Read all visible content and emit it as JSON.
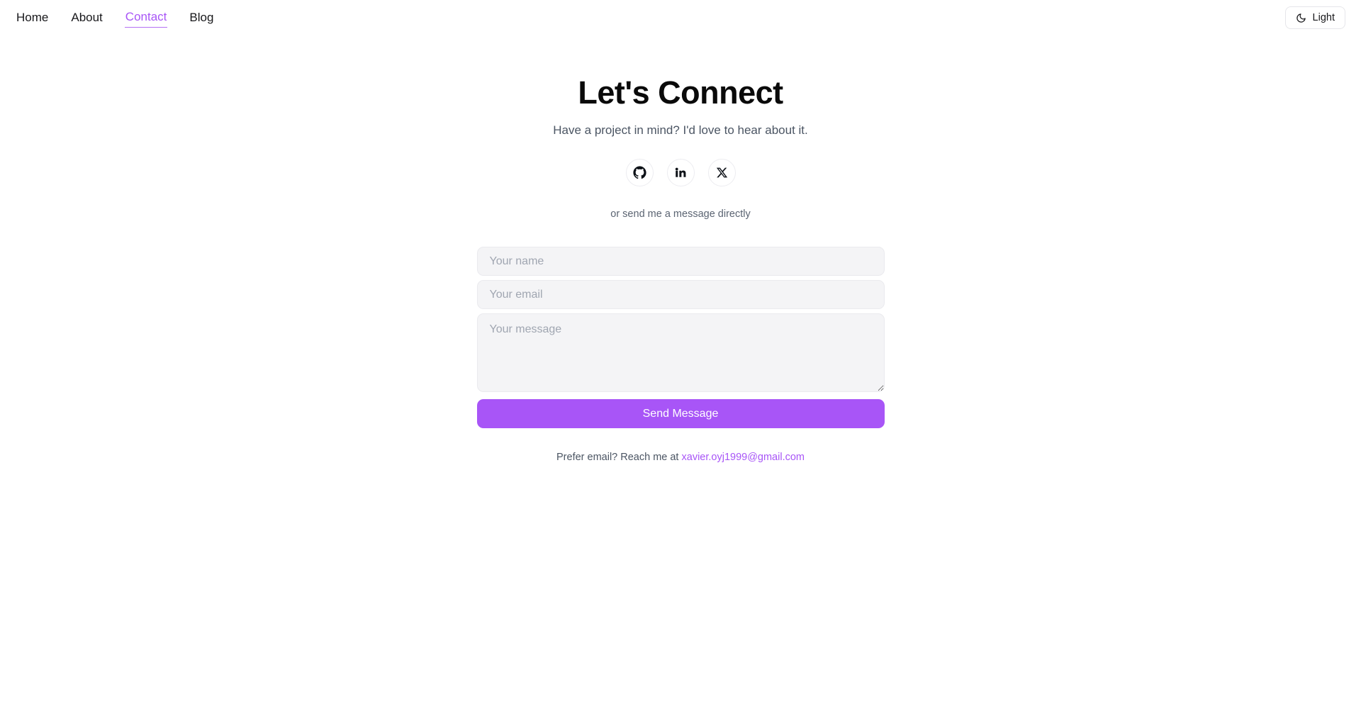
{
  "nav": {
    "items": [
      {
        "label": "Home",
        "active": false
      },
      {
        "label": "About",
        "active": false
      },
      {
        "label": "Contact",
        "active": true
      },
      {
        "label": "Blog",
        "active": false
      }
    ],
    "theme_toggle": {
      "label": "Light",
      "icon": "moon-icon"
    }
  },
  "hero": {
    "title": "Let's Connect",
    "subtitle": "Have a project in mind? I'd love to hear about it."
  },
  "social": {
    "items": [
      {
        "name": "github",
        "icon": "github-icon"
      },
      {
        "name": "linkedin",
        "icon": "linkedin-icon"
      },
      {
        "name": "x",
        "icon": "x-icon"
      }
    ]
  },
  "form": {
    "direct_note": "or send me a message directly",
    "name_placeholder": "Your name",
    "name_value": "",
    "email_placeholder": "Your email",
    "email_value": "",
    "message_placeholder": "Your message",
    "message_value": "",
    "submit_label": "Send Message"
  },
  "footer": {
    "email_prefix": "Prefer email? Reach me at ",
    "email_address": "xavier.oyj1999@gmail.com"
  },
  "colors": {
    "accent": "#a855f7",
    "page_background": "#ffffff",
    "field_background": "#f4f4f6",
    "text_primary": "#0a0a0a",
    "text_muted": "#4b5563",
    "placeholder": "#a0a6b1"
  }
}
